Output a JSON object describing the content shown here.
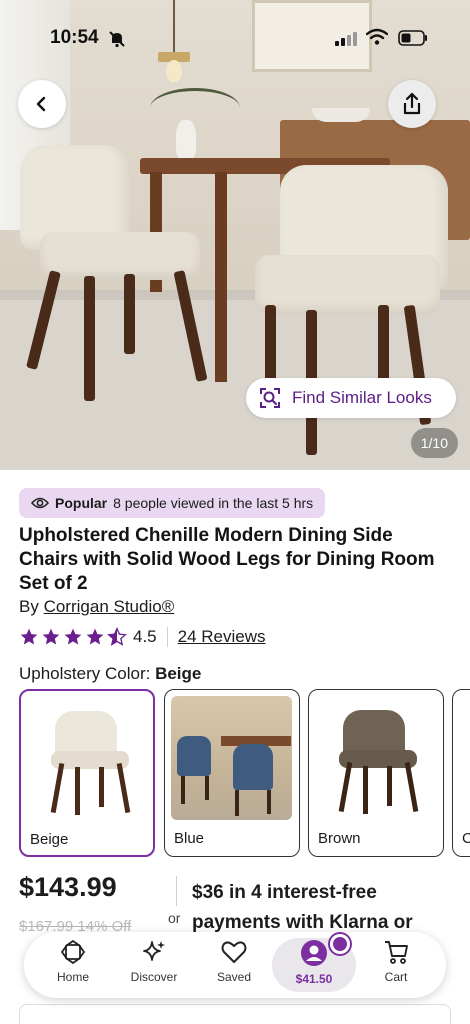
{
  "status_bar": {
    "time": "10:54"
  },
  "hero": {
    "find_similar_label": "Find Similar Looks",
    "image_counter": "1/10"
  },
  "popular": {
    "tag": "Popular",
    "text": "8 people viewed in the last 5 hrs"
  },
  "product": {
    "title": "Upholstered Chenille Modern Dining Side Chairs with Solid Wood Legs for Dining Room Set of 2",
    "by_prefix": "By",
    "brand": "Corrigan Studio®",
    "rating": 4.5,
    "rating_text": "4.5",
    "reviews_label": "24 Reviews",
    "color_label": "Upholstery Color:",
    "selected_color": "Beige"
  },
  "swatches": [
    {
      "name": "Beige",
      "selected": true
    },
    {
      "name": "Blue",
      "selected": false
    },
    {
      "name": "Brown",
      "selected": false
    },
    {
      "name": "C",
      "selected": false
    }
  ],
  "pricing": {
    "price": "$143.99",
    "old_price": "$167.99 14% Off",
    "or_label": "or",
    "klarna_text": "$36 in 4 interest-free payments with Klarna or"
  },
  "nav": {
    "items": [
      {
        "label": "Home",
        "icon": "home-icon"
      },
      {
        "label": "Discover",
        "icon": "sparkle-icon"
      },
      {
        "label": "Saved",
        "icon": "heart-icon"
      },
      {
        "label": "$41.50",
        "icon": "account-icon"
      },
      {
        "label": "Cart",
        "icon": "cart-icon"
      }
    ]
  },
  "colors": {
    "accent": "#7b2fa0",
    "popular_bg": "#ead7f2",
    "star": "#6a1f8c"
  }
}
